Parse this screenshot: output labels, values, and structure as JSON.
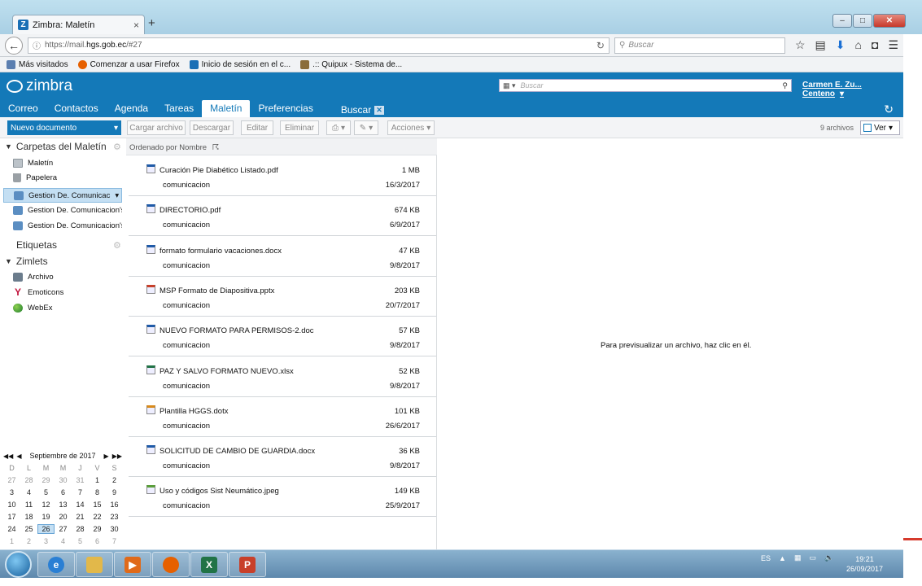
{
  "browser": {
    "tab_title": "Zimbra: Maletín",
    "tab_close": "×",
    "new_tab": "+",
    "url_prefix": "https://mail.",
    "url_domain": "hgs.gob.ec",
    "url_suffix": "/#27",
    "search_placeholder": "Buscar",
    "bookmarks": [
      {
        "label": "Más visitados",
        "icon": "bookmark-icon",
        "color": "#5b7fb0"
      },
      {
        "label": "Comenzar a usar Firefox",
        "icon": "firefox-icon",
        "color": "#e66000"
      },
      {
        "label": "Inicio de sesión en el c...",
        "icon": "zimbra-icon",
        "color": "#1a6fb5"
      },
      {
        "label": ".:: Quipux - Sistema de...",
        "icon": "quipux-icon",
        "color": "#8a6d3b"
      }
    ]
  },
  "zimbra": {
    "logo": "zimbra",
    "search_placeholder": "Buscar",
    "user": "Carmen E. Zu... Centeno",
    "tabs": [
      {
        "label": "Correo"
      },
      {
        "label": "Contactos"
      },
      {
        "label": "Agenda"
      },
      {
        "label": "Tareas"
      },
      {
        "label": "Maletín",
        "active": true
      },
      {
        "label": "Preferencias"
      },
      {
        "label": "Buscar"
      }
    ],
    "brand_color": "#1479b8"
  },
  "toolbar": {
    "new_doc": "Nuevo documento",
    "upload": "Cargar archivo",
    "download": "Descargar",
    "edit": "Editar",
    "delete": "Eliminar",
    "actions": "Acciones",
    "file_count": "9 archivos",
    "view": "Ver"
  },
  "sidebar": {
    "folders_header": "Carpetas del Maletín",
    "folders": [
      {
        "label": "Maletín",
        "icon": "folder-icon"
      },
      {
        "label": "Papelera",
        "icon": "trash-icon"
      },
      {
        "label": "Gestion De. Comunicac",
        "icon": "shared-folder-icon",
        "selected": true
      },
      {
        "label": "Gestion De. Comunicacion's",
        "icon": "shared-folder-icon"
      },
      {
        "label": "Gestion De. Comunicacion's",
        "icon": "shared-folder-icon"
      }
    ],
    "tags_header": "Etiquetas",
    "zimlets_header": "Zimlets",
    "zimlets": [
      {
        "label": "Archivo",
        "icon": "archive-icon"
      },
      {
        "label": "Emoticons",
        "icon": "yahoo-icon"
      },
      {
        "label": "WebEx",
        "icon": "webex-icon"
      }
    ]
  },
  "calendar": {
    "title": "Septiembre de 2017",
    "dow": [
      "D",
      "L",
      "M",
      "M",
      "J",
      "V",
      "S"
    ],
    "weeks": [
      [
        {
          "d": "27",
          "o": true
        },
        {
          "d": "28",
          "o": true
        },
        {
          "d": "29",
          "o": true
        },
        {
          "d": "30",
          "o": true
        },
        {
          "d": "31",
          "o": true
        },
        {
          "d": "1"
        },
        {
          "d": "2"
        }
      ],
      [
        {
          "d": "3"
        },
        {
          "d": "4"
        },
        {
          "d": "5"
        },
        {
          "d": "6"
        },
        {
          "d": "7"
        },
        {
          "d": "8"
        },
        {
          "d": "9"
        }
      ],
      [
        {
          "d": "10"
        },
        {
          "d": "11"
        },
        {
          "d": "12"
        },
        {
          "d": "13"
        },
        {
          "d": "14"
        },
        {
          "d": "15"
        },
        {
          "d": "16"
        }
      ],
      [
        {
          "d": "17"
        },
        {
          "d": "18"
        },
        {
          "d": "19"
        },
        {
          "d": "20"
        },
        {
          "d": "21"
        },
        {
          "d": "22"
        },
        {
          "d": "23"
        }
      ],
      [
        {
          "d": "24"
        },
        {
          "d": "25"
        },
        {
          "d": "26",
          "t": true
        },
        {
          "d": "27"
        },
        {
          "d": "28"
        },
        {
          "d": "29"
        },
        {
          "d": "30"
        }
      ],
      [
        {
          "d": "1",
          "o": true
        },
        {
          "d": "2",
          "o": true
        },
        {
          "d": "3",
          "o": true
        },
        {
          "d": "4",
          "o": true
        },
        {
          "d": "5",
          "o": true
        },
        {
          "d": "6",
          "o": true
        },
        {
          "d": "7",
          "o": true
        }
      ]
    ]
  },
  "list": {
    "sort_label": "Ordenado por Nombre",
    "files": [
      {
        "name": "Curación Pie Diabético Listado.pdf",
        "size": "1 MB",
        "owner": "comunicacion",
        "date": "16/3/2017",
        "icon": "pdf-icon",
        "color": "#1e5aa8"
      },
      {
        "name": "DIRECTORIO.pdf",
        "size": "674 KB",
        "owner": "comunicacion",
        "date": "6/9/2017",
        "icon": "pdf-icon",
        "color": "#1e5aa8"
      },
      {
        "name": "formato formulario vacaciones.docx",
        "size": "47 KB",
        "owner": "comunicacion",
        "date": "9/8/2017",
        "icon": "word-icon",
        "color": "#1e5aa8"
      },
      {
        "name": "MSP Formato de Diapositiva.pptx",
        "size": "203 KB",
        "owner": "comunicacion",
        "date": "20/7/2017",
        "icon": "powerpoint-icon",
        "color": "#c8402a"
      },
      {
        "name": "NUEVO FORMATO PARA PERMISOS-2.doc",
        "size": "57 KB",
        "owner": "comunicacion",
        "date": "9/8/2017",
        "icon": "word-icon",
        "color": "#1e5aa8"
      },
      {
        "name": "PAZ Y SALVO FORMATO NUEVO.xlsx",
        "size": "52 KB",
        "owner": "comunicacion",
        "date": "9/8/2017",
        "icon": "excel-icon",
        "color": "#217346"
      },
      {
        "name": "Plantilla HGGS.dotx",
        "size": "101 KB",
        "owner": "comunicacion",
        "date": "26/6/2017",
        "icon": "template-icon",
        "color": "#d98a1a"
      },
      {
        "name": "SOLICITUD DE CAMBIO DE GUARDIA.docx",
        "size": "36 KB",
        "owner": "comunicacion",
        "date": "9/8/2017",
        "icon": "word-icon",
        "color": "#1e5aa8"
      },
      {
        "name": "Uso y códigos Sist Neumático.jpeg",
        "size": "149 KB",
        "owner": "comunicacion",
        "date": "25/9/2017",
        "icon": "image-icon",
        "color": "#5a9e3a"
      }
    ]
  },
  "preview": {
    "message": "Para previsualizar un archivo, haz clic en él."
  },
  "taskbar": {
    "apps": [
      {
        "name": "ie-icon",
        "color": "#2a7fd4",
        "glyph": "e"
      },
      {
        "name": "explorer-icon",
        "color": "#e2b84a",
        "glyph": ""
      },
      {
        "name": "media-player-icon",
        "color": "#e06a1a",
        "glyph": "▶"
      },
      {
        "name": "firefox-icon",
        "color": "#e66000",
        "glyph": ""
      },
      {
        "name": "excel-icon",
        "color": "#217346",
        "glyph": "X"
      },
      {
        "name": "powerpoint-icon",
        "color": "#c8402a",
        "glyph": "P"
      }
    ],
    "lang": "ES",
    "time": "19:21",
    "date": "26/09/2017"
  }
}
